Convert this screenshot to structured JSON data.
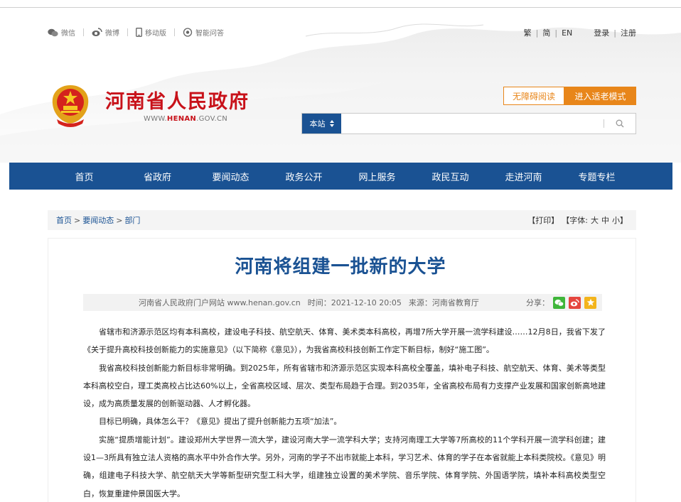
{
  "util": {
    "wechat": "微信",
    "weibo": "微博",
    "mobile": "移动版",
    "qa": "智能问答"
  },
  "lang": {
    "trad": "繁",
    "simp": "简",
    "en": "EN",
    "login": "登录",
    "register": "注册"
  },
  "brand": {
    "title": "河南省人民政府",
    "domain_prefix": "WWW.",
    "domain_mid": "HENAN",
    "domain_suffix": ".GOV.CN"
  },
  "access": {
    "barrier_free": "无障碍阅读",
    "elder": "进入适老模式"
  },
  "search": {
    "scope": "本站",
    "placeholder": ""
  },
  "nav": [
    "首页",
    "省政府",
    "要闻动态",
    "政务公开",
    "网上服务",
    "政民互动",
    "走进河南",
    "专题专栏"
  ],
  "breadcrumb": {
    "home": "首页",
    "news": "要闻动态",
    "dept": "部门"
  },
  "tools": {
    "print": "【打印】",
    "font_label": "【字体:",
    "big": "大",
    "mid": "中",
    "small": "小】"
  },
  "article": {
    "title": "河南将组建一批新的大学",
    "source_site": "河南省人民政府门户网站 www.henan.gov.cn",
    "time": "时间：2021-12-10 20:05",
    "origin": "来源：河南省教育厅",
    "share": "分享：",
    "paragraphs": [
      "省辖市和济源示范区均有本科高校，建设电子科技、航空航天、体育、美术类本科高校，再增7所大学开展一流学科建设……12月8日，我省下发了《关于提升高校科技创新能力的实施意见》（以下简称《意见》），为我省高校科技创新工作定下新目标，制好“施工图”。",
      "我省高校科技创新能力新目标非常明确。到2025年，所有省辖市和济源示范区实现本科高校全覆盖，填补电子科技、航空航天、体育、美术等类型本科高校空白，理工类高校占比达60%以上，全省高校区域、层次、类型布局趋于合理。到2035年，全省高校布局有力支撑产业发展和国家创新高地建设，成为高质量发展的创新驱动器、人才孵化器。",
      "目标已明确，具体怎么干？《意见》提出了提升创新能力五项“加法”。",
      "实施“提质增能计划”。建设郑州大学世界一流大学，建设河南大学一流学科大学；支持河南理工大学等7所高校的11个学科开展一流学科创建；建设1—3所具有独立法人资格的高水平中外合作大学。另外，河南的学子不出市就能上本科，学习艺术、体育的学子在本省就能上本科类院校。《意见》明确，组建电子科技大学、航空航天大学等新型研究型工科大学，组建独立设置的美术学院、音乐学院、体育学院、外国语学院，填补本科高校类型空白，恢复重建仲景国医大学。"
    ]
  },
  "colors": {
    "brand_red": "#c8121a",
    "nav_blue": "#1a5293",
    "accent_orange": "#e8861a"
  },
  "icons": [
    "wechat-icon",
    "weibo-icon",
    "mobile-icon",
    "qa-icon",
    "emblem-icon",
    "search-icon",
    "sort-icon",
    "wechat-share-icon",
    "weibo-share-icon",
    "favorite-icon"
  ]
}
